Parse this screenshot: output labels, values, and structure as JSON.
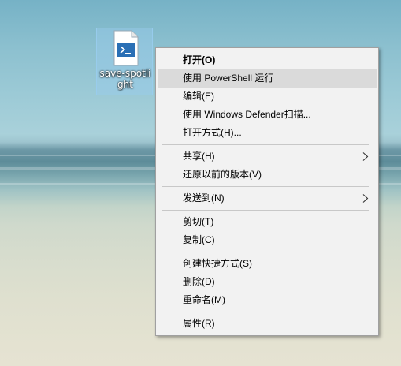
{
  "desktop_icon": {
    "label": "save-spotlight",
    "icon": "powershell-script-file-icon"
  },
  "menu": {
    "items": [
      {
        "label": "打开(O)"
      },
      {
        "label": "使用 PowerShell 运行"
      },
      {
        "label": "编辑(E)"
      },
      {
        "label": "使用 Windows Defender扫描..."
      },
      {
        "label": "打开方式(H)..."
      },
      {
        "label": "共享(H)"
      },
      {
        "label": "还原以前的版本(V)"
      },
      {
        "label": "发送到(N)"
      },
      {
        "label": "剪切(T)"
      },
      {
        "label": "复制(C)"
      },
      {
        "label": "创建快捷方式(S)"
      },
      {
        "label": "删除(D)"
      },
      {
        "label": "重命名(M)"
      },
      {
        "label": "属性(R)"
      }
    ],
    "submenu_icon": "chevron-right-icon",
    "highlight_color": "#dadada"
  }
}
